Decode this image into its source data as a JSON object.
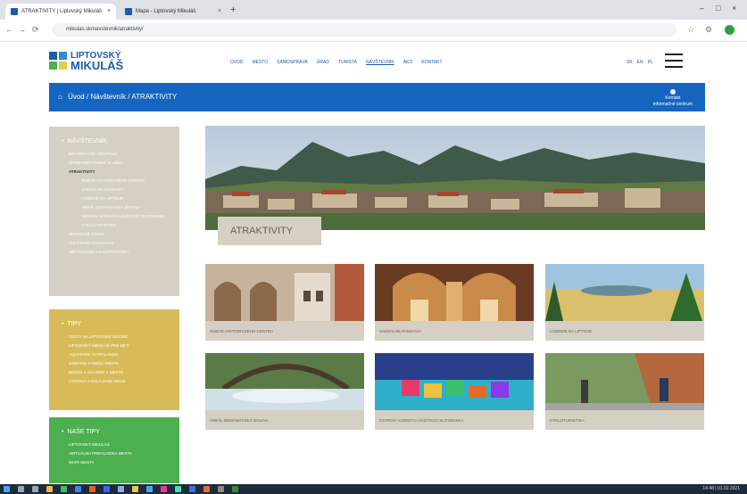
{
  "browser": {
    "tabs": [
      {
        "title": "ATRAKTIVITY | Liptovský Mikuláš"
      },
      {
        "title": "Mapa - Liptovský Mikuláš"
      }
    ],
    "new_tab": "+",
    "url": "mikulas.sk/navstevnik/atraktivity/",
    "controls": {
      "minimize": "–",
      "maximize": "□",
      "close": "×"
    },
    "nav": {
      "back": "←",
      "forward": "→",
      "reload": "⟳"
    }
  },
  "site": {
    "logo": {
      "line1": "LIPTOVSKÝ",
      "line2": "MIKULÁŠ"
    },
    "topnav": [
      "ÚVOD",
      "MESTO",
      "SAMOSPRÁVA",
      "ÚRAD",
      "TURISTA",
      "NÁVŠTEVNÍK",
      "AKO",
      "KONTAKT"
    ],
    "topnav_active": "NÁVŠTEVNÍK",
    "langs": [
      "SK",
      "EN",
      "PL"
    ]
  },
  "breadcrumb": {
    "home": "Úvod",
    "sep": "/",
    "level1": "Návštevník",
    "level2": "ATRAKTIVITY"
  },
  "contact": {
    "label": "Kontakt",
    "sub": "informačné centrum"
  },
  "sidebar": {
    "navi": {
      "title": "NÁVŠTEVNÍK",
      "items": [
        {
          "label": "INFORMAČNÉ CENTRUM",
          "level": 1
        },
        {
          "label": "SPRIEVODCOVSKÉ SLUŽBY",
          "level": 1
        },
        {
          "label": "ATRAKTIVITY",
          "level": 1,
          "current": true
        },
        {
          "label": "SÚBOR HISTORICKÉHO CENTRA",
          "level": 2
        },
        {
          "label": "SAKRÁLNE PAMIATKY",
          "level": 2
        },
        {
          "label": "LODENIE NA LIPTOVE",
          "level": 2
        },
        {
          "label": "AREÁL DEMÄNOVSKÁ DOLINA",
          "level": 2
        },
        {
          "label": "OSTROV VODNÝCH ZÁŽITKOV SLOVENSKA",
          "level": 2
        },
        {
          "label": "CYKLOTURISTIKA",
          "level": 2
        },
        {
          "label": "PRÍRODNÉ KRÁSY",
          "level": 1
        },
        {
          "label": "KULTÚRNE PODUJATIA",
          "level": 1
        },
        {
          "label": "UBYTOVANIE A GASTRONÓMIA",
          "level": 1
        }
      ]
    },
    "tips": {
      "title": "TIPY",
      "items": [
        "CESTA NA LIPTOVSKÉ MODRÉ",
        "LIPTOVSKÝ MIKULÁŠ PRE DETI",
        "AQUAPARK TATRALANDIA",
        "JASKYNE V OKOLÍ MESTA",
        "MÚZEÁ A GALÉRIE V MESTE",
        "VÝSTAVY A KULTÚRNE AKCIE"
      ]
    },
    "nase": {
      "title": "NAŠE TIPY",
      "items": [
        "LIPTOVSKÝ MIKULÁŠ",
        "VIRTUÁLNA PREHLIADKA MESTA",
        "MAPA MESTA"
      ]
    }
  },
  "hero": {
    "label": "ATRAKTIVITY"
  },
  "cards": [
    {
      "caption": "SÚBOR HISTORICKÉHO CENTRA"
    },
    {
      "caption": "SAKRÁLNE PAMIATKY"
    },
    {
      "caption": "LODENIE NA LIPTOVE"
    },
    {
      "caption": "AREÁL DEMÄNOVSKÁ DOLINA"
    },
    {
      "caption": "OSTROV VODNÝCH ZÁŽITKOV SLOVENSKA"
    },
    {
      "caption": "CYKLOTURISTIKA"
    }
  ],
  "taskbar": {
    "clock": "14:48 | 01.02.2021"
  },
  "colors": {
    "brand_blue": "#1565c0",
    "sidebar_beige": "#d6cfc5",
    "tips_yellow": "#d8bb59",
    "naše_green": "#4caf50"
  }
}
